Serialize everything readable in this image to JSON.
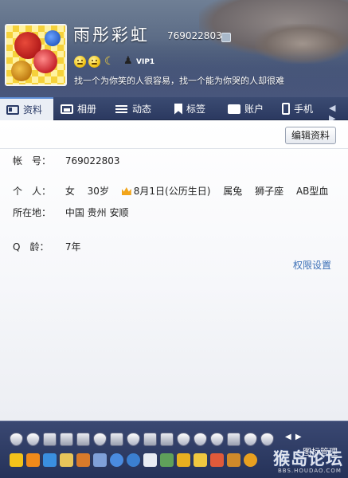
{
  "profile": {
    "nickname": "雨彤彩虹",
    "qq_number": "769022803",
    "vip_label": "VIP1",
    "signature": "找一个为你笑的人很容易，找一个能为你哭的人却很难"
  },
  "tabs": [
    {
      "label": "资料",
      "icon": "profile-card-icon",
      "active": true
    },
    {
      "label": "相册",
      "icon": "photo-icon",
      "active": false
    },
    {
      "label": "动态",
      "icon": "feed-list-icon",
      "active": false
    },
    {
      "label": "标签",
      "icon": "bookmark-icon",
      "active": false
    },
    {
      "label": "账户",
      "icon": "wallet-icon",
      "active": false
    },
    {
      "label": "手机",
      "icon": "phone-icon",
      "active": false
    }
  ],
  "tab_scroll_arrows": "◀ ▶",
  "content": {
    "edit_button": "编辑资料",
    "account": {
      "label": "帐　号：",
      "value": "769022803"
    },
    "personal": {
      "label": "个　人：",
      "gender": "女",
      "age": "30岁",
      "birthday": "8月1日(公历生日)",
      "zodiac": "属兔",
      "constellation": "狮子座",
      "blood_type": "AB型血"
    },
    "location": {
      "label": "所在地：",
      "value": "中国 贵州 安顺"
    },
    "q_age": {
      "label": "Q　龄：",
      "value": "7年"
    },
    "permission_link": "权限设置"
  },
  "bottom": {
    "row_arrows": "◀ ▶",
    "icon_manage": "图标管理",
    "watermark": "猴岛论坛",
    "watermark_url": "BBS.HOUDAO.COM"
  },
  "colors": {
    "tab_active_bg": "#eaeef5",
    "tab_bar_bg": "#2b3960",
    "link": "#3b6fb6",
    "bottom_bar_bg": "#253259"
  }
}
